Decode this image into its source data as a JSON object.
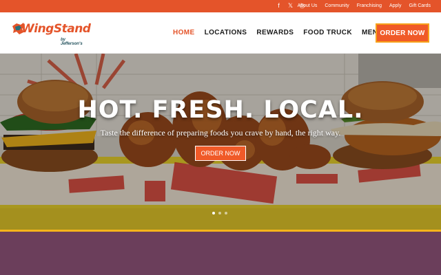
{
  "colors": {
    "accent": "#e4542a",
    "button": "#f05a28",
    "button_border": "#f7a21b",
    "stripe": "#f6b41b",
    "section_bg": "#6b3e5b",
    "logo_teal": "#1f4f5a"
  },
  "topbar": {
    "social_icons": [
      "facebook-icon",
      "x-twitter-icon",
      "instagram-icon"
    ],
    "social_glyphs": {
      "facebook": "f",
      "twitter": "𝕏",
      "instagram": "◎"
    },
    "links": [
      "About Us",
      "Community",
      "Franchising",
      "Apply",
      "Gift Cards"
    ]
  },
  "header": {
    "logo": {
      "word": "WingStand",
      "sub": "by Jefferson's"
    },
    "nav": [
      "HOME",
      "LOCATIONS",
      "REWARDS",
      "FOOD TRUCK",
      "MENU"
    ],
    "active_nav": "HOME",
    "order_label": "ORDER NOW"
  },
  "hero": {
    "headline": "HOT. FRESH. LOCAL.",
    "tagline": "Taste the difference of preparing foods you crave by hand, the right way.",
    "cta_label": "ORDER NOW",
    "slides": 3,
    "active_slide": 1
  }
}
